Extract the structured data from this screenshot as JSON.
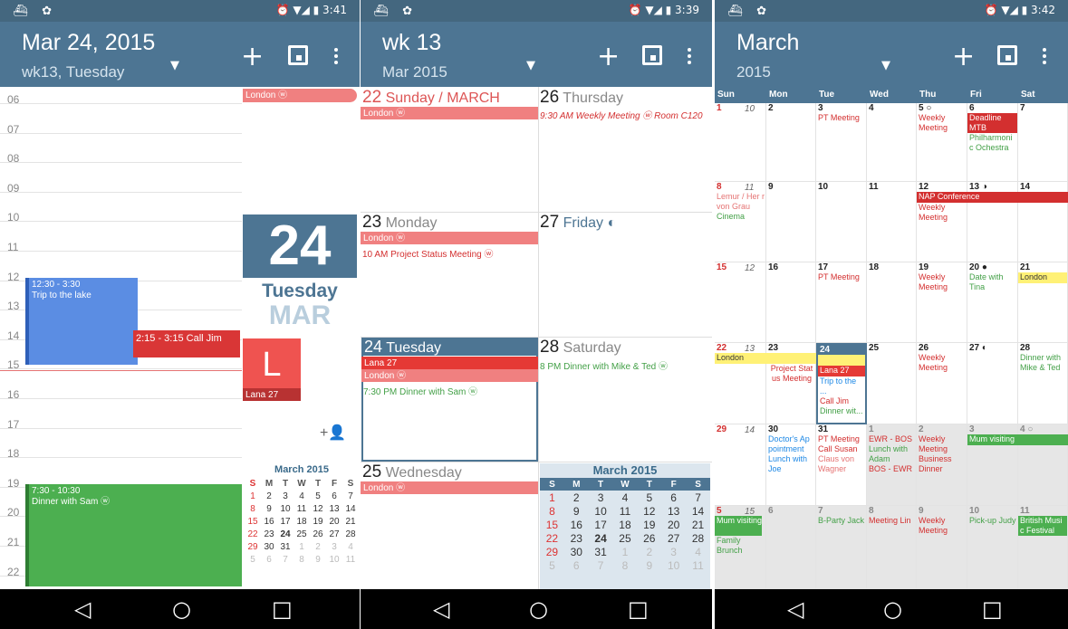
{
  "p1": {
    "time": "3:41",
    "title": "Mar 24, 2015",
    "subtitle": "wk13, Tuesday",
    "hours": [
      "06",
      "07",
      "08",
      "09",
      "10",
      "11",
      "12",
      "13",
      "14",
      "15",
      "16",
      "17",
      "18",
      "19",
      "20",
      "21",
      "22"
    ],
    "ev1": "12:30 - 3:30\nTrip to the lake",
    "ev2": "2:15 - 3:15 Call Jim",
    "ev3": "7:30 - 10:30\nDinner with Sam ⓦ",
    "london": "London ⓦ",
    "big_day": "24",
    "big_weekday": "Tuesday",
    "big_month": "MAR",
    "lana_letter": "L",
    "lana": "Lana 27",
    "add_person_icon": "person-add-icon",
    "mini": {
      "title": "March 2015",
      "head": [
        "S",
        "M",
        "T",
        "W",
        "T",
        "F",
        "S"
      ],
      "rows": [
        [
          "1",
          "2",
          "3",
          "4",
          "5",
          "6",
          "7"
        ],
        [
          "8",
          "9",
          "10",
          "11",
          "12",
          "13",
          "14"
        ],
        [
          "15",
          "16",
          "17",
          "18",
          "19",
          "20",
          "21"
        ],
        [
          "22",
          "23",
          "24",
          "25",
          "26",
          "27",
          "28"
        ],
        [
          "29",
          "30",
          "31",
          "1",
          "2",
          "3",
          "4"
        ],
        [
          "5",
          "6",
          "7",
          "8",
          "9",
          "10",
          "11"
        ]
      ]
    }
  },
  "p2": {
    "time": "3:39",
    "title": "wk 13",
    "subtitle": "Mar 2015",
    "d22": {
      "num": "22",
      "name": "Sunday / MARCH"
    },
    "d22ev": "London ⓦ",
    "d26": {
      "num": "26",
      "name": "Thursday"
    },
    "d26ev": "9:30 AM Weekly Meeting ⓦ Room C120",
    "d23": {
      "num": "23",
      "name": "Monday"
    },
    "d23ev1": "London ⓦ",
    "d23ev2": "10 AM Project Status Meeting ⓦ",
    "d27": {
      "num": "27",
      "name": "Friday ◐"
    },
    "d24": {
      "num": "24",
      "name": "Tuesday"
    },
    "d24ev1": "Lana 27",
    "d24ev2": "London ⓦ",
    "d24ev3": "7:30 PM Dinner with Sam ⓦ",
    "d28": {
      "num": "28",
      "name": "Saturday"
    },
    "d28ev": "8 PM Dinner with Mike & Ted ⓦ",
    "d25": {
      "num": "25",
      "name": "Wednesday"
    },
    "d25ev": "London ⓦ",
    "mini": {
      "title": "March 2015"
    }
  },
  "p3": {
    "time": "3:42",
    "title": "March",
    "subtitle": "2015",
    "head": [
      "Sun",
      "Mon",
      "Tue",
      "Wed",
      "Thu",
      "Fri",
      "Sat"
    ],
    "wk": [
      "10",
      "11",
      "12",
      "13",
      "14",
      "15"
    ],
    "r1": [
      "1",
      "2",
      "3",
      "4",
      "5 ○",
      "6",
      "7"
    ],
    "pt1": "PT Meeting",
    "wm1": "Weekly Meeting",
    "deadline": "Deadline MTB",
    "phil": "Philharmoni c Ochestra",
    "r2": [
      "8",
      "9",
      "10",
      "11",
      "12",
      "13 ◑",
      "14"
    ],
    "lemur": "Lemur / Her r von Grau",
    "cinema": "Cinema",
    "nap": "NAP Conference",
    "wm2": "Weekly Meeting",
    "r3": [
      "15",
      "16",
      "17",
      "18",
      "19",
      "20 ●",
      "21"
    ],
    "pt3": "PT Meeting",
    "wm3": "Weekly Meeting",
    "tina": "Date with Tina",
    "london3": "London",
    "r4": [
      "22",
      "23",
      "24",
      "25",
      "26",
      "27 ◐",
      "28"
    ],
    "london4": "London",
    "psm": "Project Stat us Meeting",
    "lana": "Lana 27",
    "trip": "Trip to the ...",
    "calljim": "Call Jim",
    "dinnerw": "Dinner wit...",
    "wm4": "Weekly Meeting",
    "mike": "Dinner with Mike & Ted",
    "r5": [
      "29",
      "30",
      "31",
      "1",
      "2",
      "3",
      "4 ○"
    ],
    "doc": "Doctor's Ap pointment",
    "lunchjoe": "Lunch with Joe",
    "pt5": "PT Meeting",
    "callsusan": "Call Susan",
    "claus": "Claus von Wagner",
    "ewr": "EWR - BOS",
    "lunchadam": "Lunch with Adam",
    "bos": "BOS - EWR",
    "wm5": "Weekly Meeting",
    "busdin": "Business Dinner",
    "mum5": "Mum visiting",
    "r6": [
      "5",
      "6",
      "7",
      "8",
      "9",
      "10",
      "11"
    ],
    "mum6": "Mum visiting",
    "brunch": "Family Brunch",
    "bparty": "B-Party Jack",
    "meetlin": "Meeting Lin",
    "wm6": "Weekly Meeting",
    "pickup": "Pick-up Judy",
    "british": "British Musi c Festival"
  }
}
